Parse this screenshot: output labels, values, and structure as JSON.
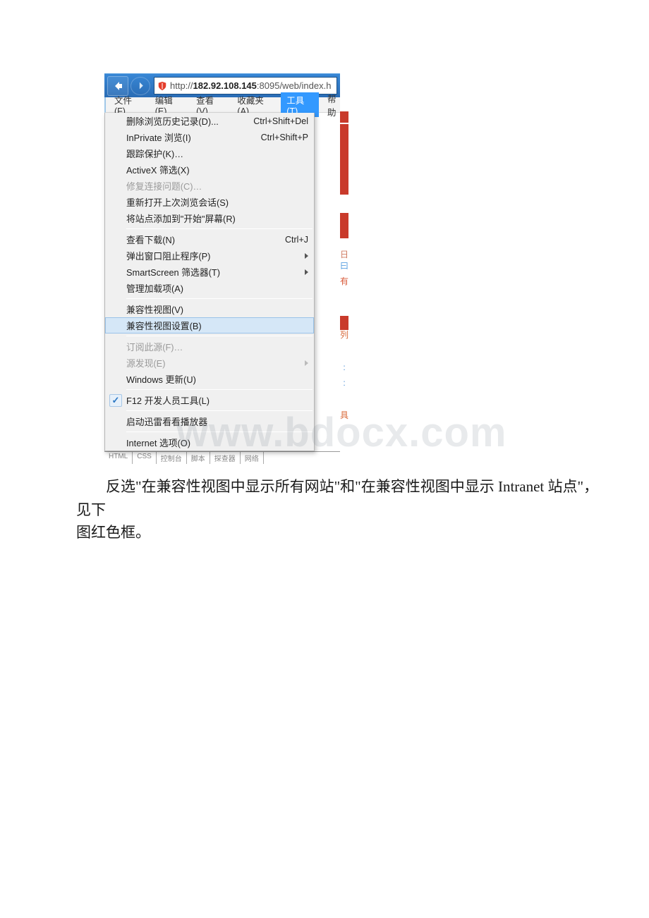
{
  "address": {
    "prefix": "http://",
    "bold": "182.92.108.145",
    "suffix": ":8095/web/index.h"
  },
  "menubar": {
    "file": "文件(F)",
    "edit": "编辑(E)",
    "view": "查看(V)",
    "favorites": "收藏夹(A)",
    "tools": "工具(T)",
    "help": "帮助"
  },
  "dropdown": {
    "g1": {
      "delete_history": "删除浏览历史记录(D)...",
      "delete_history_sc": "Ctrl+Shift+Del",
      "inprivate": "InPrivate 浏览(I)",
      "inprivate_sc": "Ctrl+Shift+P",
      "tracking": "跟踪保护(K)…",
      "activex": "ActiveX 筛选(X)",
      "fix_conn": "修复连接问题(C)…",
      "reopen": "重新打开上次浏览会话(S)",
      "add_start": "将站点添加到\"开始\"屏幕(R)"
    },
    "g2": {
      "downloads": "查看下载(N)",
      "downloads_sc": "Ctrl+J",
      "popup": "弹出窗口阻止程序(P)",
      "smart": "SmartScreen 筛选器(T)",
      "addons": "管理加载项(A)"
    },
    "g3": {
      "compat_view": "兼容性视图(V)",
      "compat_settings": "兼容性视图设置(B)"
    },
    "g4": {
      "subscribe": "订阅此源(F)…",
      "feed_discover": "源发现(E)",
      "win_update": "Windows 更新(U)"
    },
    "g5": {
      "f12": "F12 开发人员工具(L)"
    },
    "g6": {
      "xunlei": "启动迅雷看看播放器"
    },
    "g7": {
      "internet_options": "Internet 选项(O)"
    }
  },
  "bottom_tabs": [
    "HTML",
    "CSS",
    "控制台",
    "脚本",
    "探查器",
    "网络"
  ],
  "caption": {
    "line1": "反选\"在兼容性视图中显示所有网站\"和\"在兼容性视图中显示 Intranet 站点\"，见下",
    "line2": "图红色框。"
  },
  "watermark": "www.bdocx.com"
}
